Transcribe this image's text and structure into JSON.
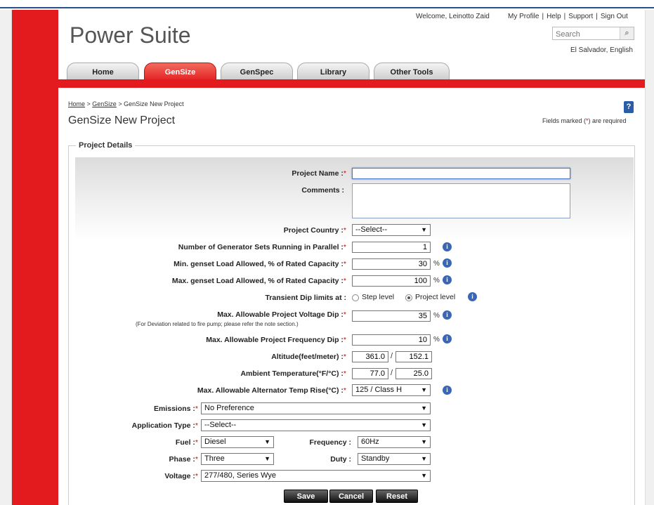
{
  "app": {
    "logo": "Power Suite",
    "welcome": "Welcome, Leinotto Zaid",
    "links": [
      "My Profile",
      "Help",
      "Support",
      "Sign Out"
    ],
    "search_placeholder": "Search",
    "locale": "El Salvador, English"
  },
  "tabs": [
    {
      "label": "Home",
      "active": false
    },
    {
      "label": "GenSize",
      "active": true
    },
    {
      "label": "GenSpec",
      "active": false
    },
    {
      "label": "Library",
      "active": false
    },
    {
      "label": "Other Tools",
      "active": false
    }
  ],
  "breadcrumb": {
    "home": "Home",
    "gensize": "GenSize",
    "current": "GenSize New Project",
    "sep": " > "
  },
  "page_title": "GenSize New Project",
  "required_note": {
    "before": "Fields marked (",
    "star": "*",
    "after": ") are required"
  },
  "section_title": "Project Details",
  "form": {
    "project_name": {
      "label": "Project Name :",
      "value": ""
    },
    "comments": {
      "label": "Comments :",
      "value": ""
    },
    "project_country": {
      "label": "Project Country :",
      "value": "--Select--"
    },
    "num_gensets": {
      "label": "Number of Generator Sets Running in Parallel :",
      "value": "1"
    },
    "min_load": {
      "label": "Min. genset Load Allowed, % of Rated Capacity :",
      "value": "30",
      "unit": "%"
    },
    "max_load": {
      "label": "Max. genset Load Allowed, % of Rated Capacity :",
      "value": "100",
      "unit": "%"
    },
    "transient_dip": {
      "label": "Transient Dip limits at :",
      "options": [
        "Step level",
        "Project level"
      ],
      "selected": "Project level"
    },
    "voltage_dip": {
      "label": "Max. Allowable Project Voltage Dip :",
      "note": "(For Deviation related to fire pump; please refer the note section.)",
      "value": "35",
      "unit": "%"
    },
    "freq_dip": {
      "label": "Max. Allowable Project Frequency Dip :",
      "value": "10",
      "unit": "%"
    },
    "altitude": {
      "label": "Altitude(feet/meter) :",
      "feet": "361.0",
      "meter": "152.1",
      "sep": "/"
    },
    "ambient_temp": {
      "label": "Ambient Temperature(°F/°C) :",
      "f": "77.0",
      "c": "25.0",
      "sep": "/"
    },
    "alt_temp_rise": {
      "label": "Max. Allowable Alternator Temp Rise(°C) :",
      "value": "125 / Class H"
    },
    "emissions": {
      "label": "Emissions :",
      "value": "No Preference"
    },
    "application_type": {
      "label": "Application Type :",
      "value": "--Select--"
    },
    "fuel": {
      "label": "Fuel :",
      "value": "Diesel"
    },
    "frequency": {
      "label": "Frequency :",
      "value": "60Hz"
    },
    "phase": {
      "label": "Phase :",
      "value": "Three"
    },
    "duty": {
      "label": "Duty :",
      "value": "Standby"
    },
    "voltage": {
      "label": "Voltage :",
      "value": "277/480, Series Wye"
    }
  },
  "buttons": {
    "save": "Save",
    "cancel": "Cancel",
    "reset": "Reset"
  },
  "icons": {
    "help": "help-icon",
    "info": "info-icon",
    "search": "search-icon",
    "dropdown": "chevron-down-icon"
  },
  "colors": {
    "brand_red": "#e31b1f",
    "info_blue": "#3a67b5"
  }
}
